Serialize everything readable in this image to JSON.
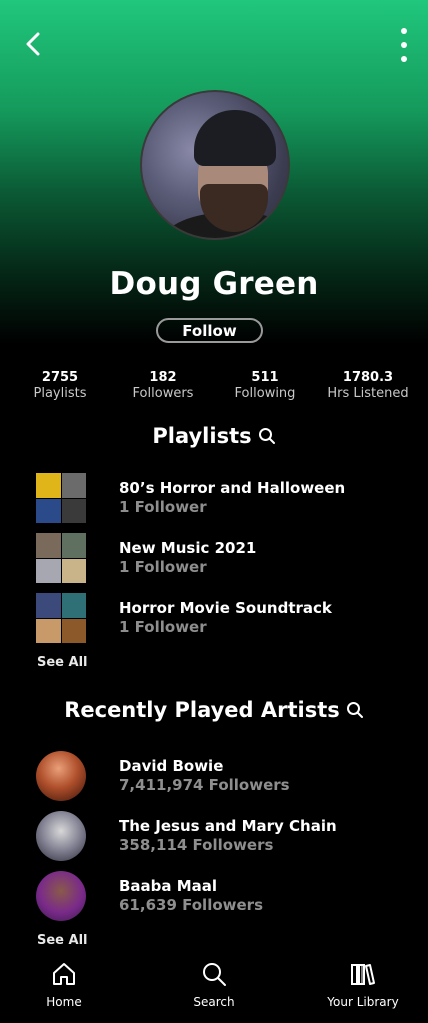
{
  "profile": {
    "name": "Doug Green",
    "follow_label": "Follow"
  },
  "stats": [
    {
      "value": "2755",
      "label": "Playlists"
    },
    {
      "value": "182",
      "label": "Followers"
    },
    {
      "value": "511",
      "label": "Following"
    },
    {
      "value": "1780.3",
      "label": "Hrs Listened"
    }
  ],
  "playlists_section": {
    "title": "Playlists",
    "see_all": "See All",
    "items": [
      {
        "title": "80’s Horror and Halloween",
        "subtitle": "1 Follower"
      },
      {
        "title": "New Music 2021",
        "subtitle": "1 Follower"
      },
      {
        "title": "Horror Movie Soundtrack",
        "subtitle": "1 Follower"
      }
    ]
  },
  "artists_section": {
    "title": "Recently Played Artists",
    "see_all": "See All",
    "items": [
      {
        "name": "David Bowie",
        "followers": "7,411,974 Followers"
      },
      {
        "name": "The Jesus and Mary Chain",
        "followers": "358,114 Followers"
      },
      {
        "name": "Baaba Maal",
        "followers": "61,639 Followers"
      }
    ]
  },
  "tabbar": {
    "home": "Home",
    "search": "Search",
    "library": "Your Library"
  },
  "colors": {
    "accent_green": "#20c77c",
    "background": "#000000",
    "muted_text": "#8e8e8e"
  }
}
